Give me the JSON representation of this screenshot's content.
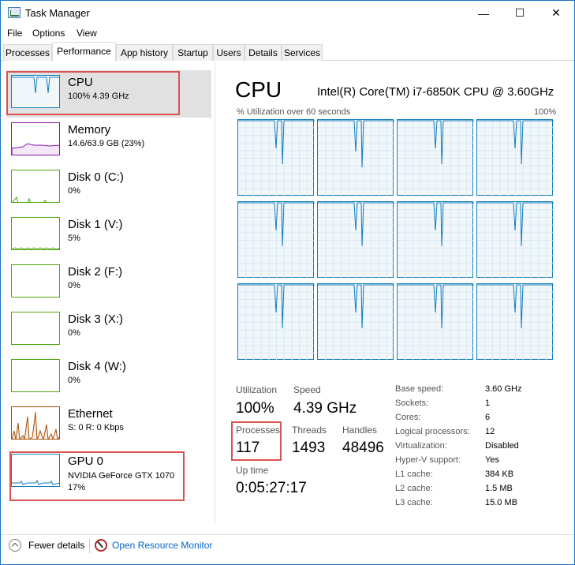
{
  "window": {
    "title": "Task Manager",
    "minimize": "—",
    "maximize": "☐",
    "close": "✕"
  },
  "menu": [
    "File",
    "Options",
    "View"
  ],
  "tabs": [
    "Processes",
    "Performance",
    "App history",
    "Startup",
    "Users",
    "Details",
    "Services"
  ],
  "resources": [
    {
      "name": "CPU",
      "sub": "100%  4.39 GHz",
      "color": "#117dbb"
    },
    {
      "name": "Memory",
      "sub": "14.6/63.9 GB (23%)",
      "color": "#8b12ae"
    },
    {
      "name": "Disk 0 (C:)",
      "sub": "0%",
      "color": "#4da60c"
    },
    {
      "name": "Disk 1 (V:)",
      "sub": "5%",
      "color": "#4da60c"
    },
    {
      "name": "Disk 2 (F:)",
      "sub": "0%",
      "color": "#4da60c"
    },
    {
      "name": "Disk 3 (X:)",
      "sub": "0%",
      "color": "#4da60c"
    },
    {
      "name": "Disk 4 (W:)",
      "sub": "0%",
      "color": "#4da60c"
    },
    {
      "name": "Ethernet",
      "sub": "S: 0  R: 0 Kbps",
      "color": "#a74f01"
    },
    {
      "name": "GPU 0",
      "sub": "NVIDIA GeForce GTX 1070",
      "sub2": "17%",
      "color": "#117dbb"
    }
  ],
  "detail": {
    "title": "CPU",
    "model": "Intel(R) Core(TM) i7-6850K CPU @ 3.60GHz",
    "graph_label": "% Utilization over 60 seconds",
    "graph_max": "100%",
    "utilization_label": "Utilization",
    "utilization_value": "100%",
    "speed_label": "Speed",
    "speed_value": "4.39 GHz",
    "processes_label": "Processes",
    "processes_value": "117",
    "threads_label": "Threads",
    "threads_value": "1493",
    "handles_label": "Handles",
    "handles_value": "48496",
    "uptime_label": "Up time",
    "uptime_value": "0:05:27:17",
    "info": [
      {
        "label": "Base speed:",
        "value": "3.60 GHz"
      },
      {
        "label": "Sockets:",
        "value": "1"
      },
      {
        "label": "Cores:",
        "value": "6"
      },
      {
        "label": "Logical processors:",
        "value": "12"
      },
      {
        "label": "Virtualization:",
        "value": "Disabled"
      },
      {
        "label": "Hyper-V support:",
        "value": "Yes"
      },
      {
        "label": "L1 cache:",
        "value": "384 KB"
      },
      {
        "label": "L2 cache:",
        "value": "1.5 MB"
      },
      {
        "label": "L3 cache:",
        "value": "15.0 MB"
      }
    ]
  },
  "footer": {
    "fewer_details": "Fewer details",
    "resource_monitor": "Open Resource Monitor"
  },
  "colors": {
    "cpu": "#117dbb",
    "memory": "#8b12ae",
    "disk": "#4da60c",
    "ethernet": "#a74f01",
    "highlight": "#d9534f"
  }
}
